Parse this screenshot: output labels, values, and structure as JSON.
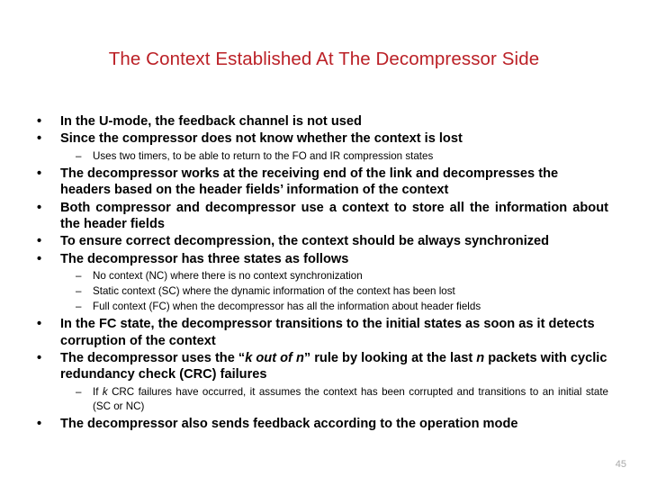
{
  "slide": {
    "title": "The Context Established At The Decompressor Side",
    "page_number": "45",
    "title_color": "#bb2026",
    "body_color": "#000000",
    "page_number_color": "#a8a8a8",
    "background": "#ffffff"
  },
  "bullets": {
    "b1": {
      "marker": "•",
      "text": "In the U-mode, the feedback channel is not used"
    },
    "b2": {
      "marker": "•",
      "text": "Since the compressor does not know whether the context is lost"
    },
    "s1": {
      "marker": "–",
      "text": "Uses two timers, to be able to return to the FO and IR compression states"
    },
    "b3": {
      "marker": "•",
      "text": "The decompressor works at the receiving end of the link and decompresses the headers based on the header fields’ information of the context"
    },
    "b4": {
      "marker": "•",
      "text": "Both compressor and decompressor use a context to store all the information about the header fields"
    },
    "b5": {
      "marker": "•",
      "text": "To ensure correct decompression, the context should be always synchronized"
    },
    "b6": {
      "marker": "•",
      "text": "The decompressor has three states as follows"
    },
    "s2": {
      "marker": "–",
      "text": "No context (NC) where there is no context synchronization"
    },
    "s3": {
      "marker": "–",
      "text": "Static context (SC) where the dynamic information of the context has been lost"
    },
    "s4": {
      "marker": "–",
      "text": "Full context (FC) when the decompressor has all the information about header fields"
    },
    "b7": {
      "marker": "•",
      "text": "In the FC state, the decompressor transitions to the initial states as soon as it detects corruption of the context"
    },
    "b8": {
      "marker": "•",
      "text_part1": "The decompressor uses the “",
      "text_italic1": "k out of n",
      "text_part2": "” rule by looking at the last ",
      "text_italic2": "n",
      "text_part3": " packets with cyclic redundancy check (CRC) failures"
    },
    "s5": {
      "marker": "–",
      "text_part1": "If ",
      "text_italic1": "k",
      "text_part2": " CRC failures have occurred, it assumes the context has been corrupted and transitions to an initial state (SC or NC)"
    },
    "b9": {
      "marker": "•",
      "text": "The decompressor also sends feedback according to the operation mode"
    }
  }
}
